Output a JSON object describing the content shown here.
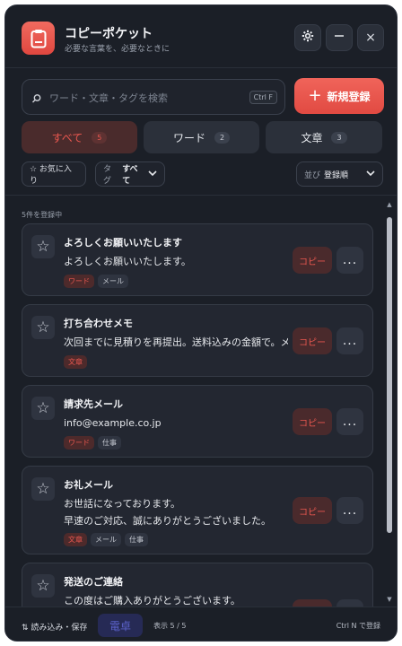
{
  "app": {
    "title": "コピーポケット",
    "subtitle": "必要な言葉を、必要なときに"
  },
  "header_buttons": {
    "settings_icon": "gear-icon",
    "minimize_icon": "minimize-icon",
    "close_label": "×"
  },
  "search": {
    "placeholder": "ワード・文章・タグを検索",
    "shortcut": "Ctrl F"
  },
  "new_button": {
    "label": "新規登録"
  },
  "tabs": [
    {
      "label": "すべて",
      "count": "5",
      "active": true
    },
    {
      "label": "ワード",
      "count": "2",
      "active": false
    },
    {
      "label": "文章",
      "count": "3",
      "active": false
    }
  ],
  "filters": {
    "favorites": "☆ お気に入り",
    "tag_label": "タグ",
    "tag_value": "すべて",
    "sort_label": "並び",
    "sort_value": "登録順"
  },
  "count_label": "5件を登録中",
  "items": [
    {
      "title": "よろしくお願いいたします",
      "body": [
        "よろしくお願いいたします。"
      ],
      "tags": [
        {
          "text": "ワード",
          "kind": "red"
        },
        {
          "text": "メール",
          "kind": "gray"
        }
      ]
    },
    {
      "title": "打ち合わせメモ",
      "body": [
        "次回までに見積りを再提出。送料込みの金額で。メモ"
      ],
      "tags": [
        {
          "text": "文章",
          "kind": "red"
        }
      ]
    },
    {
      "title": "請求先メール",
      "body": [
        "info@example.co.jp"
      ],
      "tags": [
        {
          "text": "ワード",
          "kind": "red"
        },
        {
          "text": "仕事",
          "kind": "gray"
        }
      ]
    },
    {
      "title": "お礼メール",
      "body": [
        "お世話になっております。",
        "早速のご対応、誠にありがとうございました。"
      ],
      "tags": [
        {
          "text": "文章",
          "kind": "red"
        },
        {
          "text": "メール",
          "kind": "gray"
        },
        {
          "text": "仕事",
          "kind": "gray"
        }
      ]
    },
    {
      "title": "発送のご連絡",
      "body": [
        "この度はご購入ありがとうございます。"
      ],
      "tags": []
    }
  ],
  "card_actions": {
    "copy": "コピー",
    "more": "..."
  },
  "footer": {
    "import": "⇅ 読み込み・保存",
    "dense": "電卓",
    "display": "表示 5 / 5",
    "hint": "Ctrl N で登録"
  },
  "colors": {
    "accent": "#e8574f",
    "background": "#1b1f27",
    "card": "#232731"
  }
}
